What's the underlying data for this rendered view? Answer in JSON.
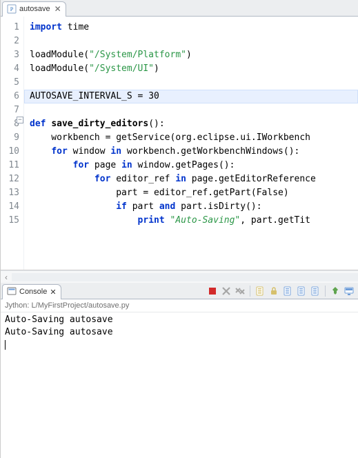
{
  "editor_tab": {
    "label": "autosave",
    "icon": "python-file-icon"
  },
  "code": {
    "lines": [
      {
        "n": 1,
        "tokens": [
          [
            "kw",
            "import"
          ],
          [
            "",
            " time"
          ]
        ]
      },
      {
        "n": 2,
        "tokens": []
      },
      {
        "n": 3,
        "tokens": [
          [
            "",
            "loadModule("
          ],
          [
            "str",
            "\"/System/Platform\""
          ],
          [
            "",
            ")"
          ]
        ]
      },
      {
        "n": 4,
        "tokens": [
          [
            "",
            "loadModule("
          ],
          [
            "str",
            "\"/System/UI\""
          ],
          [
            "",
            ")"
          ]
        ]
      },
      {
        "n": 5,
        "tokens": []
      },
      {
        "n": 6,
        "highlight": true,
        "tokens": [
          [
            "const",
            "AUTOSAVE_INTERVAL_S"
          ],
          [
            "op",
            " = "
          ],
          [
            "num",
            "30"
          ]
        ]
      },
      {
        "n": 7,
        "tokens": []
      },
      {
        "n": 8,
        "fold": true,
        "tokens": [
          [
            "kw2",
            "def "
          ],
          [
            "def",
            "save_dirty_editors"
          ],
          [
            "",
            "():"
          ]
        ]
      },
      {
        "n": 9,
        "tokens": [
          [
            "",
            "    workbench = getService(org.eclipse.ui.IWorkbench"
          ]
        ]
      },
      {
        "n": 10,
        "tokens": [
          [
            "",
            "    "
          ],
          [
            "kw",
            "for"
          ],
          [
            "",
            " window "
          ],
          [
            "kw",
            "in"
          ],
          [
            "",
            " workbench.getWorkbenchWindows():"
          ]
        ]
      },
      {
        "n": 11,
        "tokens": [
          [
            "",
            "        "
          ],
          [
            "kw",
            "for"
          ],
          [
            "",
            " page "
          ],
          [
            "kw",
            "in"
          ],
          [
            "",
            " window.getPages():"
          ]
        ]
      },
      {
        "n": 12,
        "tokens": [
          [
            "",
            "            "
          ],
          [
            "kw",
            "for"
          ],
          [
            "",
            " editor_ref "
          ],
          [
            "kw",
            "in"
          ],
          [
            "",
            " page.getEditorReference"
          ]
        ]
      },
      {
        "n": 13,
        "tokens": [
          [
            "",
            "                part = editor_ref.getPart(False)"
          ]
        ]
      },
      {
        "n": 14,
        "tokens": [
          [
            "",
            "                "
          ],
          [
            "kw",
            "if"
          ],
          [
            "",
            " part "
          ],
          [
            "kw",
            "and"
          ],
          [
            "",
            " part.isDirty():"
          ]
        ]
      },
      {
        "n": 15,
        "tokens": [
          [
            "",
            "                    "
          ],
          [
            "kw",
            "print"
          ],
          [
            "",
            " "
          ],
          [
            "str-it",
            "\"Auto-Saving\""
          ],
          [
            "",
            ", part.getTit"
          ]
        ]
      }
    ]
  },
  "console_tab": {
    "label": "Console"
  },
  "console": {
    "header": "Jython: L/MyFirstProject/autosave.py",
    "lines": [
      "Auto-Saving autosave",
      "Auto-Saving autosave"
    ]
  },
  "toolbar_icons": [
    {
      "name": "terminate-icon",
      "color": "#d22a2a",
      "shape": "square"
    },
    {
      "name": "remove-terminated-icon",
      "color": "#a6a6a6",
      "shape": "x"
    },
    {
      "name": "remove-all-icon",
      "color": "#a6a6a6",
      "shape": "xx"
    },
    {
      "sep": true
    },
    {
      "name": "clear-console-icon",
      "color": "#d6c06c",
      "shape": "page"
    },
    {
      "name": "scroll-lock-icon",
      "color": "#d6c06c",
      "shape": "lock"
    },
    {
      "name": "word-wrap-icon",
      "color": "#7ea7de",
      "shape": "page"
    },
    {
      "name": "show-when-output-icon",
      "color": "#7ea7de",
      "shape": "page"
    },
    {
      "name": "show-when-error-icon",
      "color": "#7ea7de",
      "shape": "page"
    },
    {
      "sep": true
    },
    {
      "name": "pin-console-icon",
      "color": "#5fa44f",
      "shape": "pin"
    },
    {
      "name": "display-console-icon",
      "color": "#6c9cd8",
      "shape": "monitor"
    }
  ]
}
